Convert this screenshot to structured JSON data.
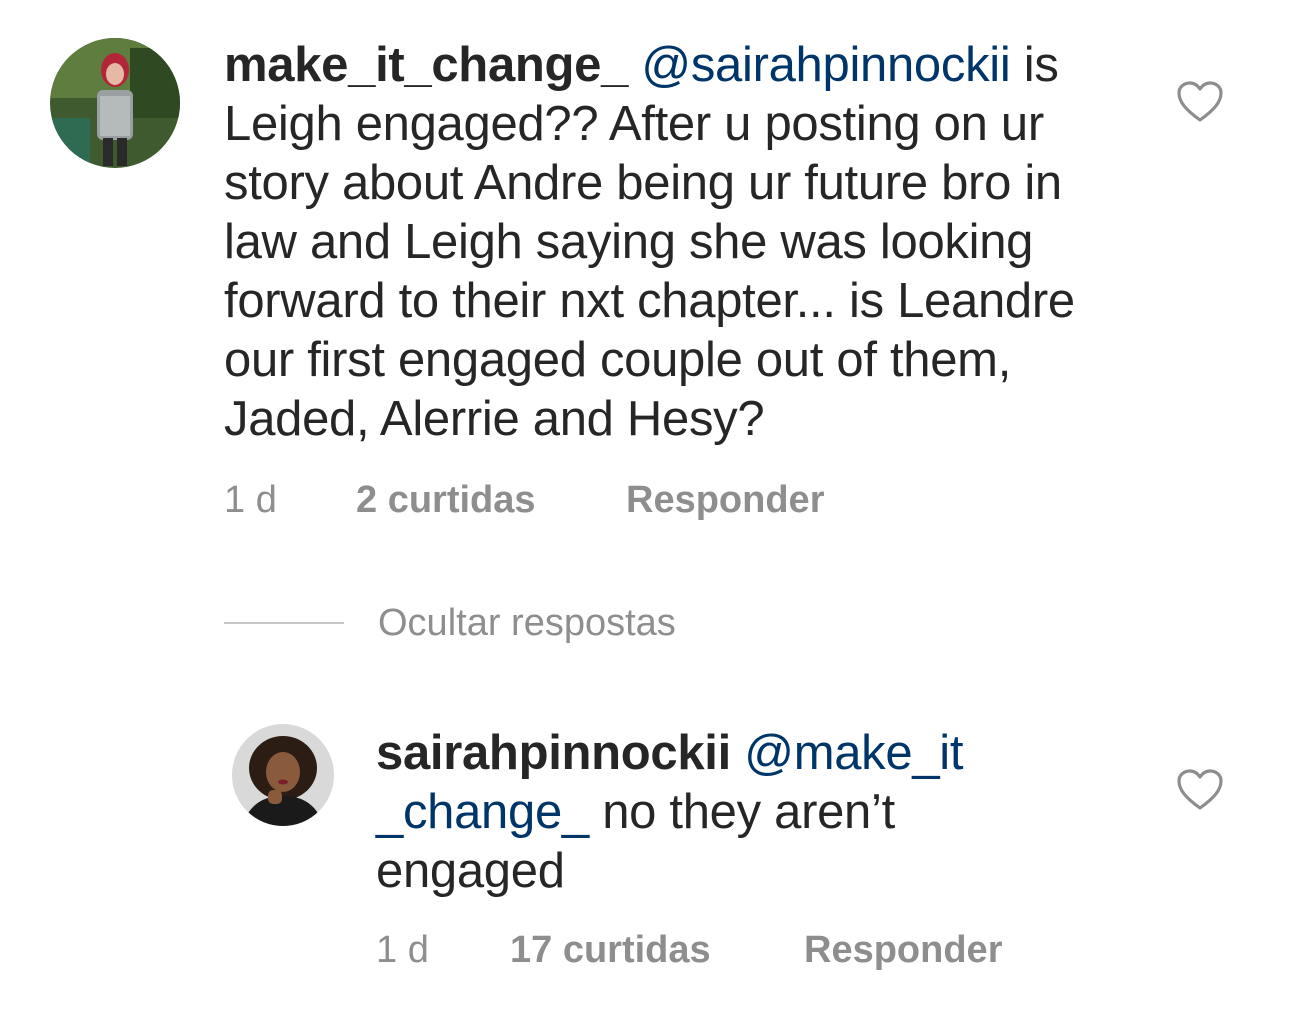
{
  "comments": [
    {
      "username": "make_it_change_",
      "mention": "@sairahpinnockii",
      "text_line1_rest": " is",
      "text_lines": [
        "Leigh engaged?? After u posting on ur",
        "story about Andre being ur future bro in",
        "law and Leigh saying she was looking",
        "forward to their nxt chapter... is Leandre",
        "our first engaged couple out of them,",
        "Jaded, Alerrie and Hesy?"
      ],
      "time": "1 d",
      "likes": "2 curtidas",
      "reply_label": "Responder",
      "like_icon": "heart-outline-icon"
    }
  ],
  "hide_replies_label": "Ocultar respostas",
  "replies": [
    {
      "username": "sairahpinnockii",
      "mention_part1": "@make_it",
      "mention_part2": "_change_",
      "text_rest": " no they aren’t",
      "text_line3": "engaged",
      "time": "1 d",
      "likes": "17 curtidas",
      "reply_label": "Responder",
      "like_icon": "heart-outline-icon"
    }
  ],
  "colors": {
    "text": "#262626",
    "mention": "#003569",
    "meta": "#8e8e8e",
    "divider": "#c7c7c7"
  }
}
